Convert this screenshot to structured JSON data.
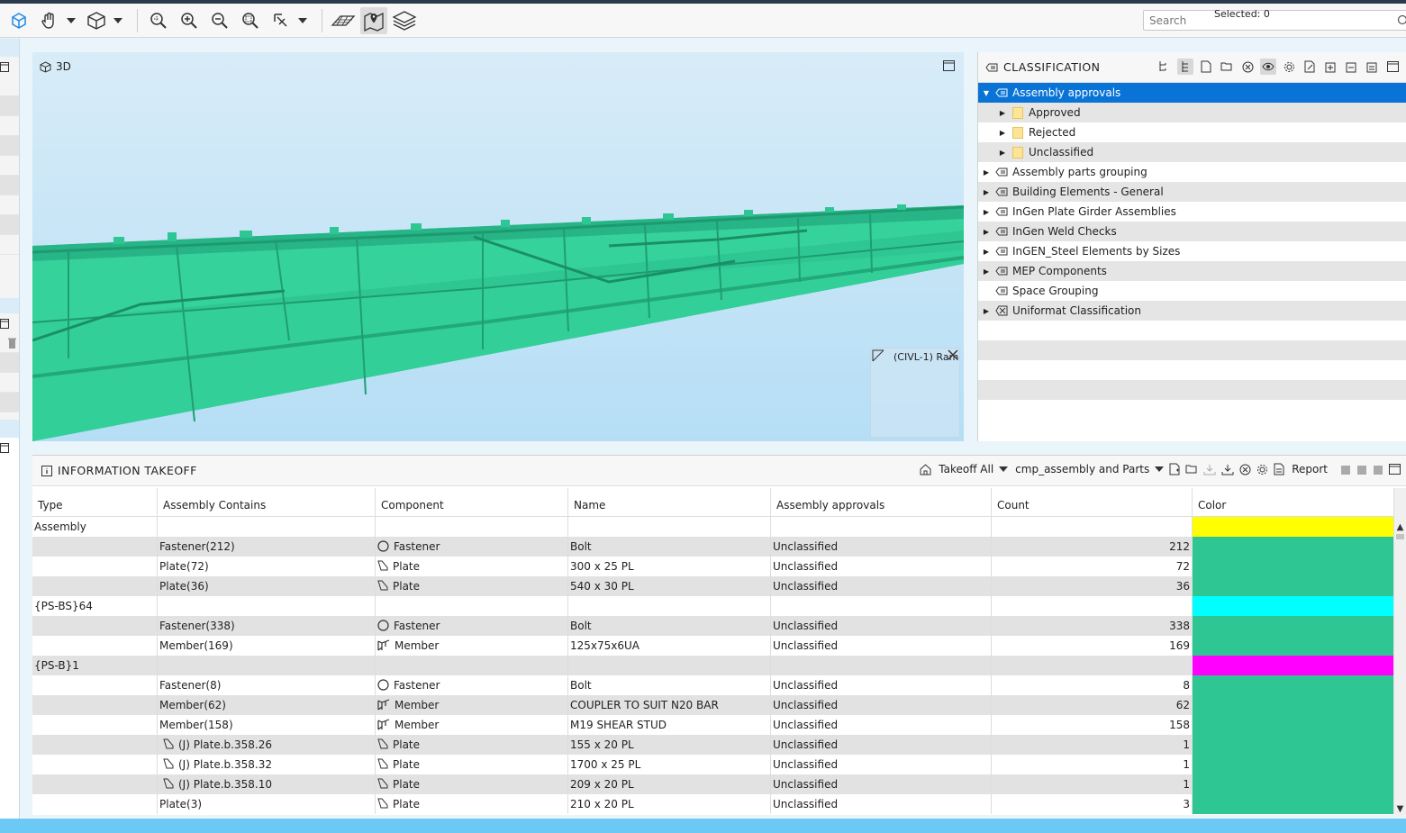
{
  "search": {
    "placeholder": "Search"
  },
  "viewport": {
    "title": "3D",
    "minimap_label": "(CIVL-1) Ram"
  },
  "classification": {
    "title": "CLASSIFICATION",
    "items": [
      {
        "label": "Assembly approvals",
        "level": 0,
        "expand": "down",
        "selected": true
      },
      {
        "label": "Approved",
        "level": 1,
        "expand": "right",
        "folder": true
      },
      {
        "label": "Rejected",
        "level": 1,
        "expand": "right",
        "folder": true
      },
      {
        "label": "Unclassified",
        "level": 1,
        "expand": "right",
        "folder": true
      },
      {
        "label": "Assembly parts grouping",
        "level": 0,
        "expand": "right"
      },
      {
        "label": "Building Elements - General",
        "level": 0,
        "expand": "right"
      },
      {
        "label": "InGen Plate Girder Assemblies",
        "level": 0,
        "expand": "right"
      },
      {
        "label": "InGen Weld Checks",
        "level": 0,
        "expand": "right"
      },
      {
        "label": "InGEN_Steel Elements by Sizes",
        "level": 0,
        "expand": "right"
      },
      {
        "label": "MEP Components",
        "level": 0,
        "expand": "right"
      },
      {
        "label": "Space Grouping",
        "level": 0,
        "expand": "none"
      },
      {
        "label": "Uniformat Classification",
        "level": 0,
        "expand": "right"
      }
    ]
  },
  "takeoff": {
    "title": "INFORMATION TAKEOFF",
    "takeoff_all_label": "Takeoff All",
    "template_label": "cmp_assembly and Parts",
    "report_label": "Report",
    "columns": [
      "Type",
      "Assembly Contains",
      "Component",
      "Name",
      "Assembly approvals",
      "Count",
      "Color"
    ],
    "rows": [
      {
        "type": "Assembly",
        "contains": "",
        "component": "",
        "comp_icon": "",
        "name": "",
        "approval": "",
        "count": "",
        "color": "#ffff00",
        "contains_icon": false
      },
      {
        "type": "",
        "contains": "Fastener(212)",
        "component": "Fastener",
        "comp_icon": "fastener",
        "name": "Bolt",
        "approval": "Unclassified",
        "count": "212",
        "color": "#2ec793",
        "contains_icon": false
      },
      {
        "type": "",
        "contains": "Plate(72)",
        "component": "Plate",
        "comp_icon": "plate",
        "name": "300 x 25  PL",
        "approval": "Unclassified",
        "count": "72",
        "color": "#2ec793",
        "contains_icon": false
      },
      {
        "type": "",
        "contains": "Plate(36)",
        "component": "Plate",
        "comp_icon": "plate",
        "name": "540 x 30  PL",
        "approval": "Unclassified",
        "count": "36",
        "color": "#2ec793",
        "contains_icon": false
      },
      {
        "type": "{PS-BS}64",
        "contains": "",
        "component": "",
        "comp_icon": "",
        "name": "",
        "approval": "",
        "count": "",
        "color": "#00ffff",
        "contains_icon": false
      },
      {
        "type": "",
        "contains": "Fastener(338)",
        "component": "Fastener",
        "comp_icon": "fastener",
        "name": "Bolt",
        "approval": "Unclassified",
        "count": "338",
        "color": "#2ec793",
        "contains_icon": false
      },
      {
        "type": "",
        "contains": "Member(169)",
        "component": "Member",
        "comp_icon": "member",
        "name": "125x75x6UA",
        "approval": "Unclassified",
        "count": "169",
        "color": "#2ec793",
        "contains_icon": false
      },
      {
        "type": "{PS-B}1",
        "contains": "",
        "component": "",
        "comp_icon": "",
        "name": "",
        "approval": "",
        "count": "",
        "color": "#ff00ff",
        "contains_icon": false
      },
      {
        "type": "",
        "contains": "Fastener(8)",
        "component": "Fastener",
        "comp_icon": "fastener",
        "name": "Bolt",
        "approval": "Unclassified",
        "count": "8",
        "color": "#2ec793",
        "contains_icon": false
      },
      {
        "type": "",
        "contains": "Member(62)",
        "component": "Member",
        "comp_icon": "member",
        "name": "COUPLER TO SUIT N20 BAR",
        "approval": "Unclassified",
        "count": "62",
        "color": "#2ec793",
        "contains_icon": false
      },
      {
        "type": "",
        "contains": "Member(158)",
        "component": "Member",
        "comp_icon": "member",
        "name": "M19 SHEAR STUD",
        "approval": "Unclassified",
        "count": "158",
        "color": "#2ec793",
        "contains_icon": false
      },
      {
        "type": "",
        "contains": "(J) Plate.b.358.26",
        "component": "Plate",
        "comp_icon": "plate",
        "name": "155 x 20  PL",
        "approval": "Unclassified",
        "count": "1",
        "color": "#2ec793",
        "contains_icon": true
      },
      {
        "type": "",
        "contains": "(J) Plate.b.358.32",
        "component": "Plate",
        "comp_icon": "plate",
        "name": "1700 x 25  PL",
        "approval": "Unclassified",
        "count": "1",
        "color": "#2ec793",
        "contains_icon": true
      },
      {
        "type": "",
        "contains": "(J) Plate.b.358.10",
        "component": "Plate",
        "comp_icon": "plate",
        "name": "209 x 20  PL",
        "approval": "Unclassified",
        "count": "1",
        "color": "#2ec793",
        "contains_icon": true
      },
      {
        "type": "",
        "contains": "Plate(3)",
        "component": "Plate",
        "comp_icon": "plate",
        "name": "210 x 20  PL",
        "approval": "Unclassified",
        "count": "3",
        "color": "#2ec793",
        "contains_icon": false
      }
    ]
  },
  "status": {
    "selected": "Selected: 0"
  },
  "colors": {
    "selection": "#0a74d6",
    "model": "#2ec793",
    "statusbar": "#6cc8f5"
  }
}
